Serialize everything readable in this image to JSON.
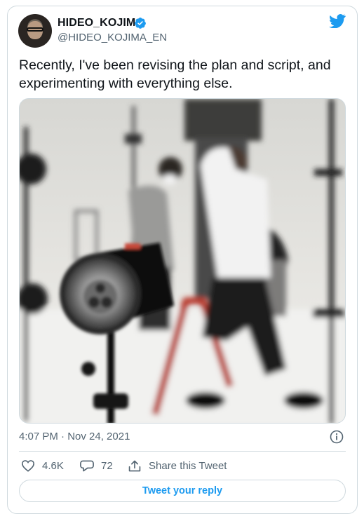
{
  "author": {
    "name": "HIDEO_KOJIMA",
    "handle": "@HIDEO_KOJIMA_EN",
    "verified": true,
    "avatar_icon": "avatar"
  },
  "brand": {
    "icon": "twitter-bird-icon",
    "color": "#1d9bf0"
  },
  "tweet": {
    "text": "Recently, I've been revising the plan and script, and experimenting with everything else.",
    "timestamp": "4:07 PM · Nov 24, 2021"
  },
  "actions": {
    "likes": "4.6K",
    "replies": "72",
    "share_label": "Share this Tweet"
  },
  "reply_button": {
    "label": "Tweet your reply"
  },
  "colors": {
    "accent": "#1d9bf0",
    "secondary_text": "#536471",
    "border": "#cfd9de"
  }
}
